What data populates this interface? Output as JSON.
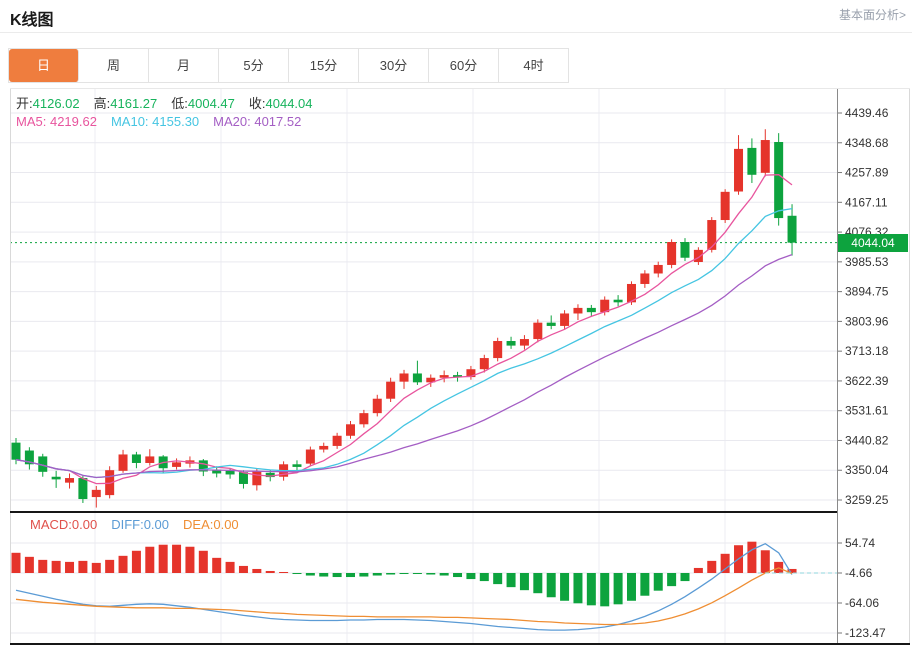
{
  "header": {
    "title": "K线图",
    "analysis_link": "基本面分析>"
  },
  "tabs": {
    "items": [
      "日",
      "周",
      "月",
      "5分",
      "15分",
      "30分",
      "60分",
      "4时"
    ],
    "active": "日"
  },
  "ohlc_legend": {
    "open_label": "开:",
    "open": "4126.02",
    "high_label": "高:",
    "high": "4161.27",
    "low_label": "低:",
    "low": "4004.47",
    "close_label": "收:",
    "close": "4044.04"
  },
  "ma_legend": {
    "ma5_label": "MA5: ",
    "ma5": "4219.62",
    "ma10_label": "MA10: ",
    "ma10": "4155.30",
    "ma20_label": "MA20: ",
    "ma20": "4017.52"
  },
  "macd_legend": {
    "macd_label": "MACD:",
    "macd": "0.00",
    "diff_label": "DIFF:",
    "diff": "0.00",
    "dea_label": "DEA:",
    "dea": "0.00"
  },
  "current_price": "4044.04",
  "colors": {
    "up": "#e5342b",
    "down": "#0da33e",
    "badge": "#0da33e",
    "value_green": "#17b35c",
    "label_dark": "#333333",
    "ma5": "#e8559e",
    "ma10": "#45c5e2",
    "ma20": "#a45ec4",
    "diff_line": "#5b9bd5",
    "dea_line": "#ef8e33",
    "macd_text": "#e0504a",
    "accent_tab": "#ef7d3e",
    "grid": "#e9e9ef",
    "axis": "#8a8a8a",
    "link_gray": "#99a0ac"
  },
  "chart_data": {
    "type": "candlestick",
    "title": "K线图",
    "price_axis_ticks": [
      "4439.46",
      "4348.68",
      "4257.89",
      "4167.11",
      "4076.32",
      "3985.53",
      "3894.75",
      "3803.96",
      "3713.18",
      "3622.39",
      "3531.61",
      "3440.82",
      "3350.04",
      "3259.25"
    ],
    "price_axis_range": [
      3259.25,
      4439.46
    ],
    "macd_axis_ticks": [
      "54.74",
      "-4.66",
      "-64.06",
      "-123.47"
    ],
    "macd_axis_range": [
      -123.47,
      54.74
    ],
    "current_price_value": 4044.04,
    "ma_periods": [
      5,
      10,
      20
    ],
    "candles": [
      [
        3434,
        3448,
        3368,
        3382
      ],
      [
        3410,
        3420,
        3352,
        3368
      ],
      [
        3392,
        3400,
        3330,
        3345
      ],
      [
        3330,
        3348,
        3296,
        3322
      ],
      [
        3312,
        3340,
        3294,
        3326
      ],
      [
        3326,
        3332,
        3250,
        3262
      ],
      [
        3268,
        3302,
        3236,
        3290
      ],
      [
        3274,
        3362,
        3264,
        3350
      ],
      [
        3348,
        3412,
        3342,
        3398
      ],
      [
        3398,
        3406,
        3356,
        3372
      ],
      [
        3372,
        3414,
        3364,
        3392
      ],
      [
        3392,
        3396,
        3342,
        3356
      ],
      [
        3360,
        3386,
        3352,
        3374
      ],
      [
        3370,
        3392,
        3358,
        3380
      ],
      [
        3380,
        3384,
        3332,
        3346
      ],
      [
        3352,
        3362,
        3328,
        3340
      ],
      [
        3348,
        3356,
        3324,
        3337
      ],
      [
        3344,
        3350,
        3294,
        3308
      ],
      [
        3304,
        3354,
        3288,
        3346
      ],
      [
        3342,
        3350,
        3316,
        3329
      ],
      [
        3330,
        3377,
        3318,
        3368
      ],
      [
        3368,
        3380,
        3348,
        3360
      ],
      [
        3370,
        3422,
        3362,
        3413
      ],
      [
        3413,
        3434,
        3404,
        3424
      ],
      [
        3424,
        3464,
        3415,
        3455
      ],
      [
        3455,
        3500,
        3446,
        3490
      ],
      [
        3490,
        3534,
        3480,
        3524
      ],
      [
        3524,
        3580,
        3514,
        3568
      ],
      [
        3568,
        3632,
        3558,
        3620
      ],
      [
        3620,
        3656,
        3598,
        3645
      ],
      [
        3645,
        3684,
        3610,
        3618
      ],
      [
        3618,
        3642,
        3604,
        3632
      ],
      [
        3632,
        3654,
        3618,
        3640
      ],
      [
        3640,
        3650,
        3620,
        3634
      ],
      [
        3634,
        3668,
        3626,
        3658
      ],
      [
        3658,
        3702,
        3648,
        3692
      ],
      [
        3692,
        3754,
        3682,
        3744
      ],
      [
        3744,
        3757,
        3720,
        3730
      ],
      [
        3730,
        3762,
        3718,
        3750
      ],
      [
        3750,
        3810,
        3740,
        3800
      ],
      [
        3800,
        3822,
        3780,
        3790
      ],
      [
        3790,
        3838,
        3778,
        3828
      ],
      [
        3828,
        3856,
        3808,
        3845
      ],
      [
        3845,
        3854,
        3818,
        3832
      ],
      [
        3832,
        3880,
        3822,
        3870
      ],
      [
        3870,
        3884,
        3850,
        3862
      ],
      [
        3862,
        3926,
        3854,
        3918
      ],
      [
        3918,
        3960,
        3906,
        3950
      ],
      [
        3950,
        3986,
        3938,
        3976
      ],
      [
        3976,
        4054,
        3966,
        4046
      ],
      [
        4046,
        4058,
        3988,
        3998
      ],
      [
        3985,
        4030,
        3976,
        4022
      ],
      [
        4022,
        4122,
        4014,
        4113
      ],
      [
        4113,
        4207,
        4104,
        4199
      ],
      [
        4200,
        4372,
        4190,
        4330
      ],
      [
        4333,
        4362,
        4226,
        4251
      ],
      [
        4257,
        4390,
        4246,
        4357
      ],
      [
        4351,
        4378,
        4096,
        4119
      ],
      [
        4126.02,
        4161.27,
        4004.47,
        4044.04
      ]
    ],
    "macd": {
      "hist": [
        40,
        32,
        26,
        24,
        22,
        24,
        20,
        26,
        34,
        44,
        52,
        56,
        56,
        52,
        44,
        30,
        22,
        14,
        8,
        4,
        2,
        -2,
        -5,
        -7,
        -8,
        -8,
        -7,
        -5,
        -3,
        -2,
        -2,
        -3,
        -5,
        -8,
        -12,
        -16,
        -22,
        -28,
        -34,
        -40,
        -48,
        -55,
        -60,
        -64,
        -66,
        -62,
        -55,
        -45,
        -35,
        -26,
        -16,
        10,
        24,
        38,
        55,
        62,
        45,
        22,
        8
      ],
      "diff": [
        -34,
        -40,
        -46,
        -52,
        -57,
        -62,
        -65,
        -66,
        -64,
        -62,
        -61,
        -62,
        -65,
        -68,
        -72,
        -76,
        -80,
        -84,
        -87,
        -90,
        -92,
        -93,
        -94,
        -94,
        -94,
        -93,
        -93,
        -92,
        -92,
        -92,
        -93,
        -94,
        -96,
        -98,
        -100,
        -103,
        -106,
        -108,
        -110,
        -112,
        -113,
        -113,
        -112,
        -110,
        -107,
        -102,
        -95,
        -86,
        -75,
        -62,
        -47,
        -30,
        -12,
        8,
        28,
        46,
        58,
        40,
        -3
      ],
      "dea": [
        -52,
        -55,
        -58,
        -60,
        -62,
        -64,
        -66,
        -67,
        -68,
        -69,
        -69,
        -69,
        -70,
        -70,
        -71,
        -72,
        -73,
        -75,
        -77,
        -79,
        -80,
        -82,
        -83,
        -84,
        -85,
        -86,
        -86,
        -87,
        -87,
        -87,
        -87,
        -87,
        -88,
        -88,
        -89,
        -90,
        -91,
        -92,
        -94,
        -96,
        -97,
        -99,
        -100,
        -101,
        -102,
        -102,
        -101,
        -99,
        -95,
        -89,
        -81,
        -71,
        -59,
        -45,
        -30,
        -14,
        0,
        10,
        -1
      ]
    }
  }
}
